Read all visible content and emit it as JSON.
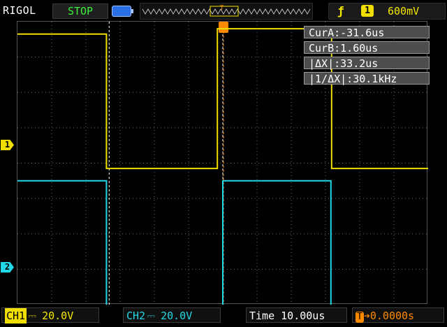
{
  "header": {
    "brand": "RIGOL",
    "run_status": "STOP",
    "trigger_edge_symbol": "ƒ",
    "trigger_source": "1",
    "trigger_level": "600mV"
  },
  "cursor_readout": {
    "cur_a": "CurA:-31.6us",
    "cur_b": "CurB:1.60us",
    "delta_x": "|ΔX|:33.2us",
    "inv_delta_x": "|1/ΔX|:30.1kHz"
  },
  "channels": {
    "ch1": {
      "label": "CH1",
      "coupling": "⎓",
      "scale": "20.0V",
      "marker": "1",
      "color": "#f0de00"
    },
    "ch2": {
      "label": "CH2",
      "coupling": "⎓",
      "scale": "20.0V",
      "marker": "2",
      "color": "#22d8e8"
    }
  },
  "timebase": {
    "time_label": "Time",
    "value": "10.00us"
  },
  "trigger_offset": {
    "icon": "T",
    "value": "➔0.0000s"
  },
  "chart_data": {
    "type": "line",
    "x_unit": "us",
    "time_per_div": 10,
    "divisions_x": 12,
    "x_range": [
      -60,
      60
    ],
    "series": [
      {
        "name": "CH1",
        "x": [
          -60,
          -34,
          -34,
          -1.6,
          -1.6,
          31.8,
          31.8,
          60
        ],
        "y_div": [
          3.65,
          3.65,
          -0.15,
          -0.15,
          3.8,
          3.8,
          -0.15,
          -0.15
        ]
      },
      {
        "name": "CH2",
        "x": [
          -60,
          -34,
          -34,
          0,
          0,
          31.6,
          31.6,
          60
        ],
        "y_div": [
          -0.5,
          -0.5,
          -4.6,
          -4.6,
          -0.5,
          -0.5,
          -4.6,
          -4.6
        ]
      }
    ],
    "cursors_x": [
      -33.2,
      0
    ],
    "trigger_x": 0,
    "grid": true
  }
}
